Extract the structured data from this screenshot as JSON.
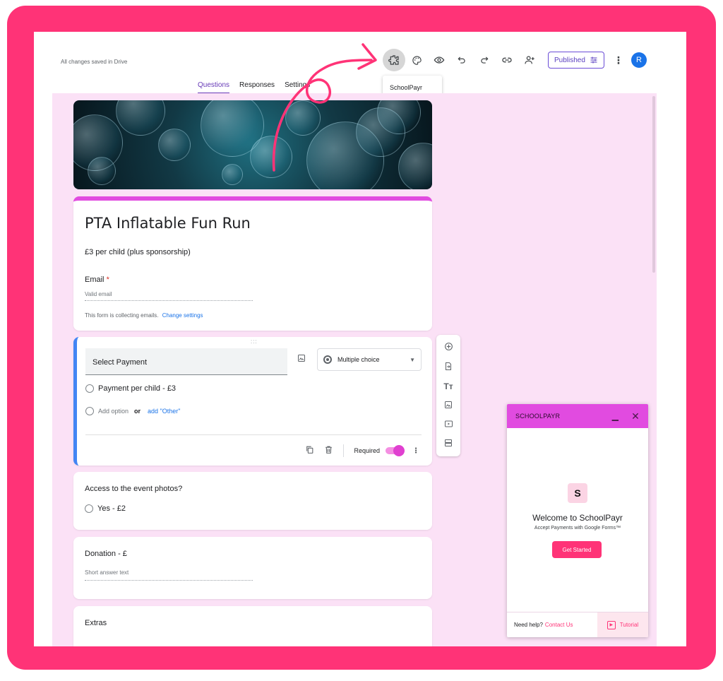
{
  "header": {
    "save_status": "All changes saved in Drive"
  },
  "toolbar": {
    "icons": [
      "addons-puzzle-icon",
      "palette-icon",
      "preview-eye-icon",
      "undo-icon",
      "redo-icon",
      "link-icon",
      "add-collaborator-icon"
    ],
    "published_label": "Published",
    "avatar_initial": "R"
  },
  "addon_menu": {
    "item": "SchoolPayr"
  },
  "tabs": [
    {
      "label": "Questions",
      "active": true
    },
    {
      "label": "Responses",
      "active": false
    },
    {
      "label": "Settings",
      "active": false
    }
  ],
  "form": {
    "title": "PTA Inflatable Fun Run",
    "description": "£3 per child (plus sponsorship)",
    "email_label": "Email",
    "email_required_mark": "*",
    "email_placeholder": "Valid email",
    "collecting_note": "This form is collecting emails.",
    "change_settings": "Change settings"
  },
  "question_edit": {
    "drag_handle": ":::",
    "title": "Select Payment",
    "type": "Multiple choice",
    "options": [
      "Payment per child - £3"
    ],
    "add_option": "Add option",
    "or": "or",
    "add_other": "add \"Other\"",
    "required_label": "Required",
    "required": true
  },
  "questions": [
    {
      "title": "Access to the event photos?",
      "option": "Yes - £2"
    },
    {
      "title": "Donation - £",
      "placeholder": "Short answer text"
    },
    {
      "title": "Extras"
    }
  ],
  "side_tools": [
    "add-question-icon",
    "import-questions-icon",
    "add-title-icon",
    "add-image-icon",
    "add-video-icon",
    "add-section-icon"
  ],
  "side_tool_glyphs": {
    "add_title": "Tт"
  },
  "schoolpayr": {
    "header": "SCHOOLPAYR",
    "logo_letter": "S",
    "welcome": "Welcome to SchoolPayr",
    "tagline": "Accept Payments with Google Forms™",
    "cta": "Get Started",
    "help_text": "Need help?",
    "contact": "Contact Us",
    "tutorial": "Tutorial"
  },
  "colors": {
    "frame": "#ff3377",
    "form_bg": "#fbe1f6",
    "accent": "#e14be0",
    "active_tab": "#673ab7",
    "link": "#1a73e8"
  }
}
